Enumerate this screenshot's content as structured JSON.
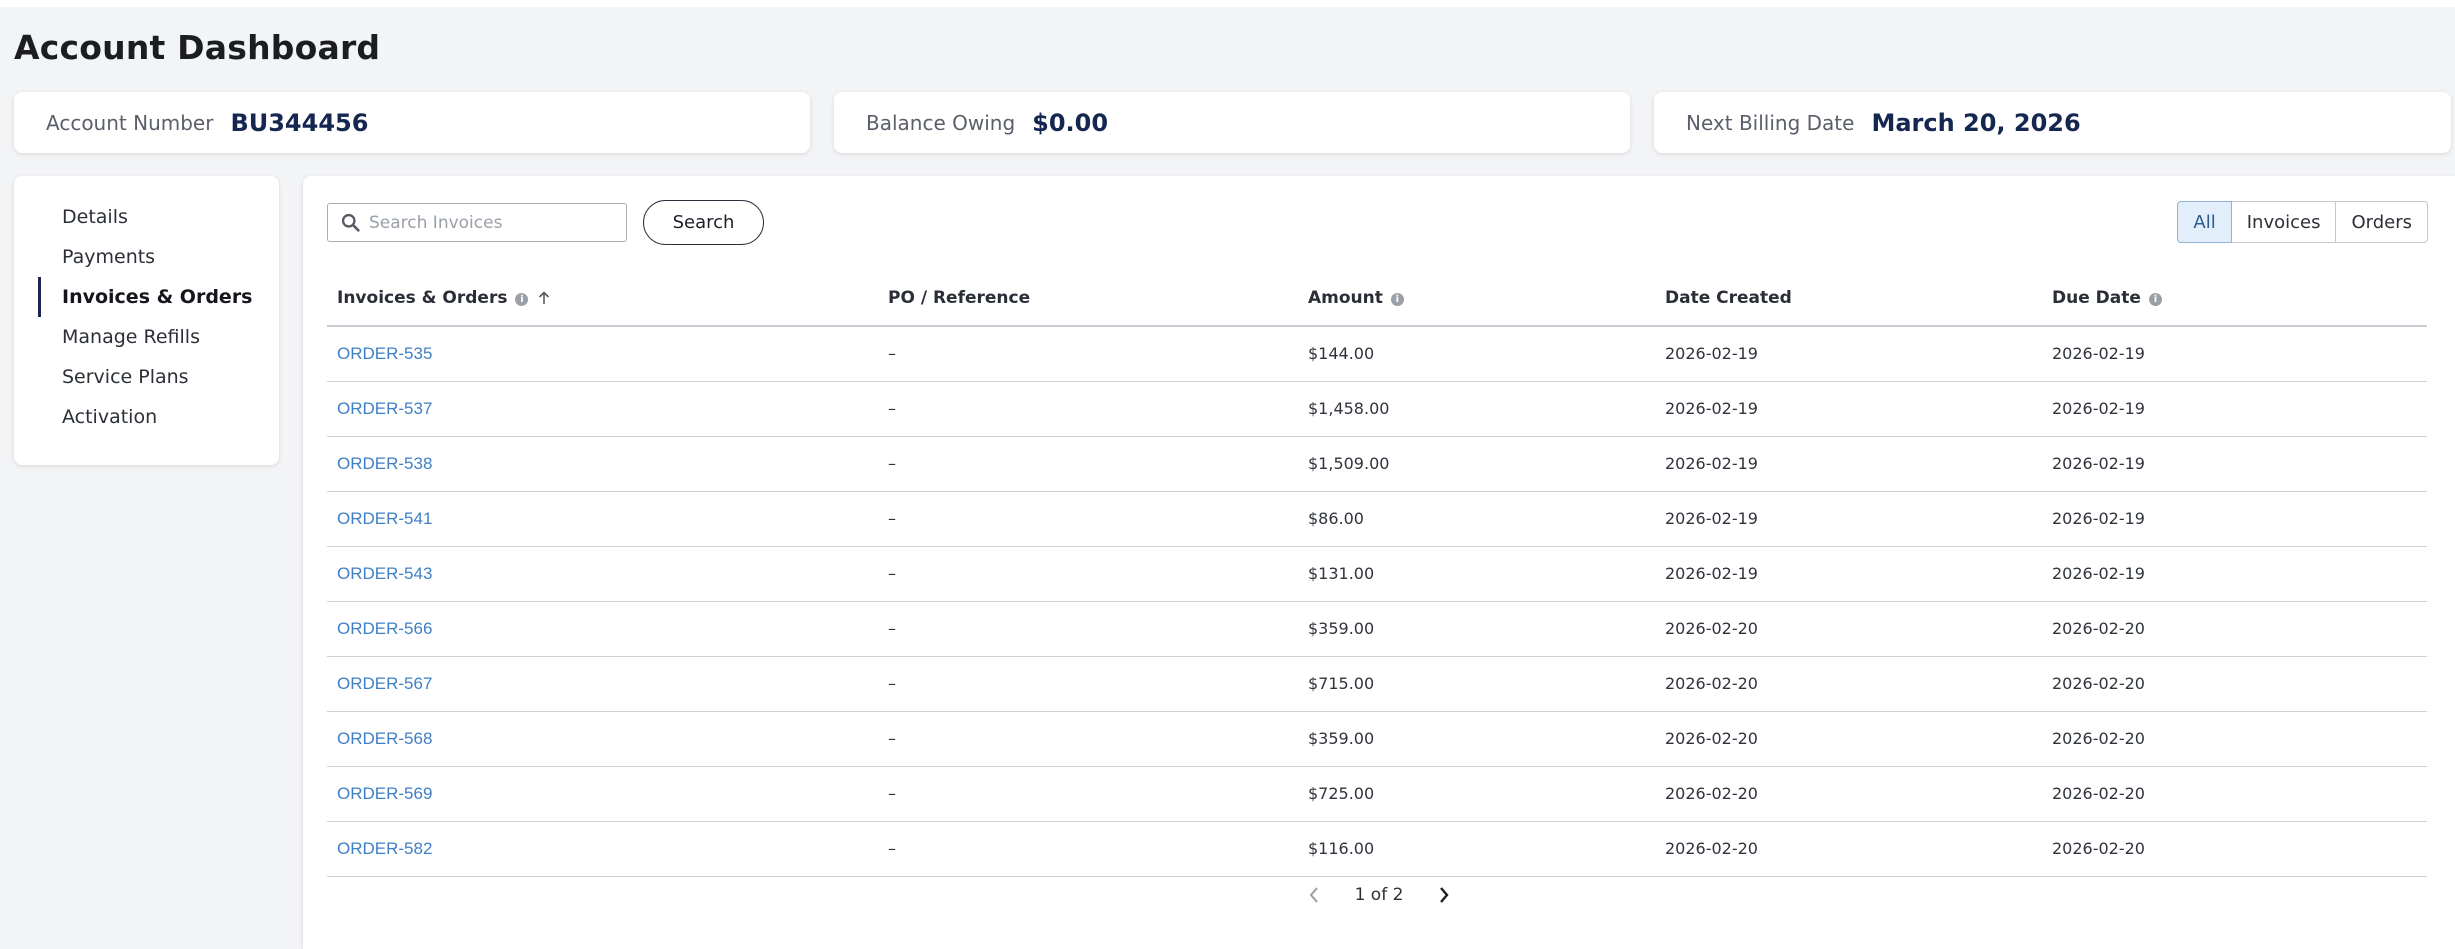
{
  "page": {
    "title": "Account Dashboard"
  },
  "summary": {
    "account": {
      "label": "Account Number",
      "value": "BU344456"
    },
    "balance": {
      "label": "Balance Owing",
      "value": "$0.00"
    },
    "billing": {
      "label": "Next Billing Date",
      "value": "March 20, 2026"
    }
  },
  "sidebar": {
    "items": [
      {
        "label": "Details"
      },
      {
        "label": "Payments"
      },
      {
        "label": "Invoices & Orders"
      },
      {
        "label": "Manage Refills"
      },
      {
        "label": "Service Plans"
      },
      {
        "label": "Activation"
      }
    ],
    "active": "Invoices & Orders"
  },
  "toolbar": {
    "search_placeholder": "Search Invoices",
    "search_value": "",
    "search_label": "Search",
    "filters": [
      "All",
      "Invoices",
      "Orders"
    ],
    "active_filter": "All"
  },
  "table": {
    "headers": {
      "order": "Invoices & Orders",
      "po": "PO / Reference",
      "amount": "Amount",
      "created": "Date Created",
      "due": "Due Date"
    },
    "rows": [
      {
        "order": "ORDER-535",
        "po": "–",
        "amount": "$144.00",
        "created": "2026-02-19",
        "due": "2026-02-19"
      },
      {
        "order": "ORDER-537",
        "po": "–",
        "amount": "$1,458.00",
        "created": "2026-02-19",
        "due": "2026-02-19"
      },
      {
        "order": "ORDER-538",
        "po": "–",
        "amount": "$1,509.00",
        "created": "2026-02-19",
        "due": "2026-02-19"
      },
      {
        "order": "ORDER-541",
        "po": "–",
        "amount": "$86.00",
        "created": "2026-02-19",
        "due": "2026-02-19"
      },
      {
        "order": "ORDER-543",
        "po": "–",
        "amount": "$131.00",
        "created": "2026-02-19",
        "due": "2026-02-19"
      },
      {
        "order": "ORDER-566",
        "po": "–",
        "amount": "$359.00",
        "created": "2026-02-20",
        "due": "2026-02-20"
      },
      {
        "order": "ORDER-567",
        "po": "–",
        "amount": "$715.00",
        "created": "2026-02-20",
        "due": "2026-02-20"
      },
      {
        "order": "ORDER-568",
        "po": "–",
        "amount": "$359.00",
        "created": "2026-02-20",
        "due": "2026-02-20"
      },
      {
        "order": "ORDER-569",
        "po": "–",
        "amount": "$725.00",
        "created": "2026-02-20",
        "due": "2026-02-20"
      },
      {
        "order": "ORDER-582",
        "po": "–",
        "amount": "$116.00",
        "created": "2026-02-20",
        "due": "2026-02-20"
      }
    ]
  },
  "pagination": {
    "text": "1 of 2"
  },
  "icons": {
    "search": "search-icon",
    "info": "info-icon",
    "sort": "sort-ascending-icon",
    "prev": "chevron-left-icon",
    "next": "chevron-right-icon"
  },
  "colors": {
    "accent": "#1b2552",
    "link": "#3f7fc6",
    "active_filter_bg": "#e2eefa",
    "background": "#f3f4f6"
  }
}
